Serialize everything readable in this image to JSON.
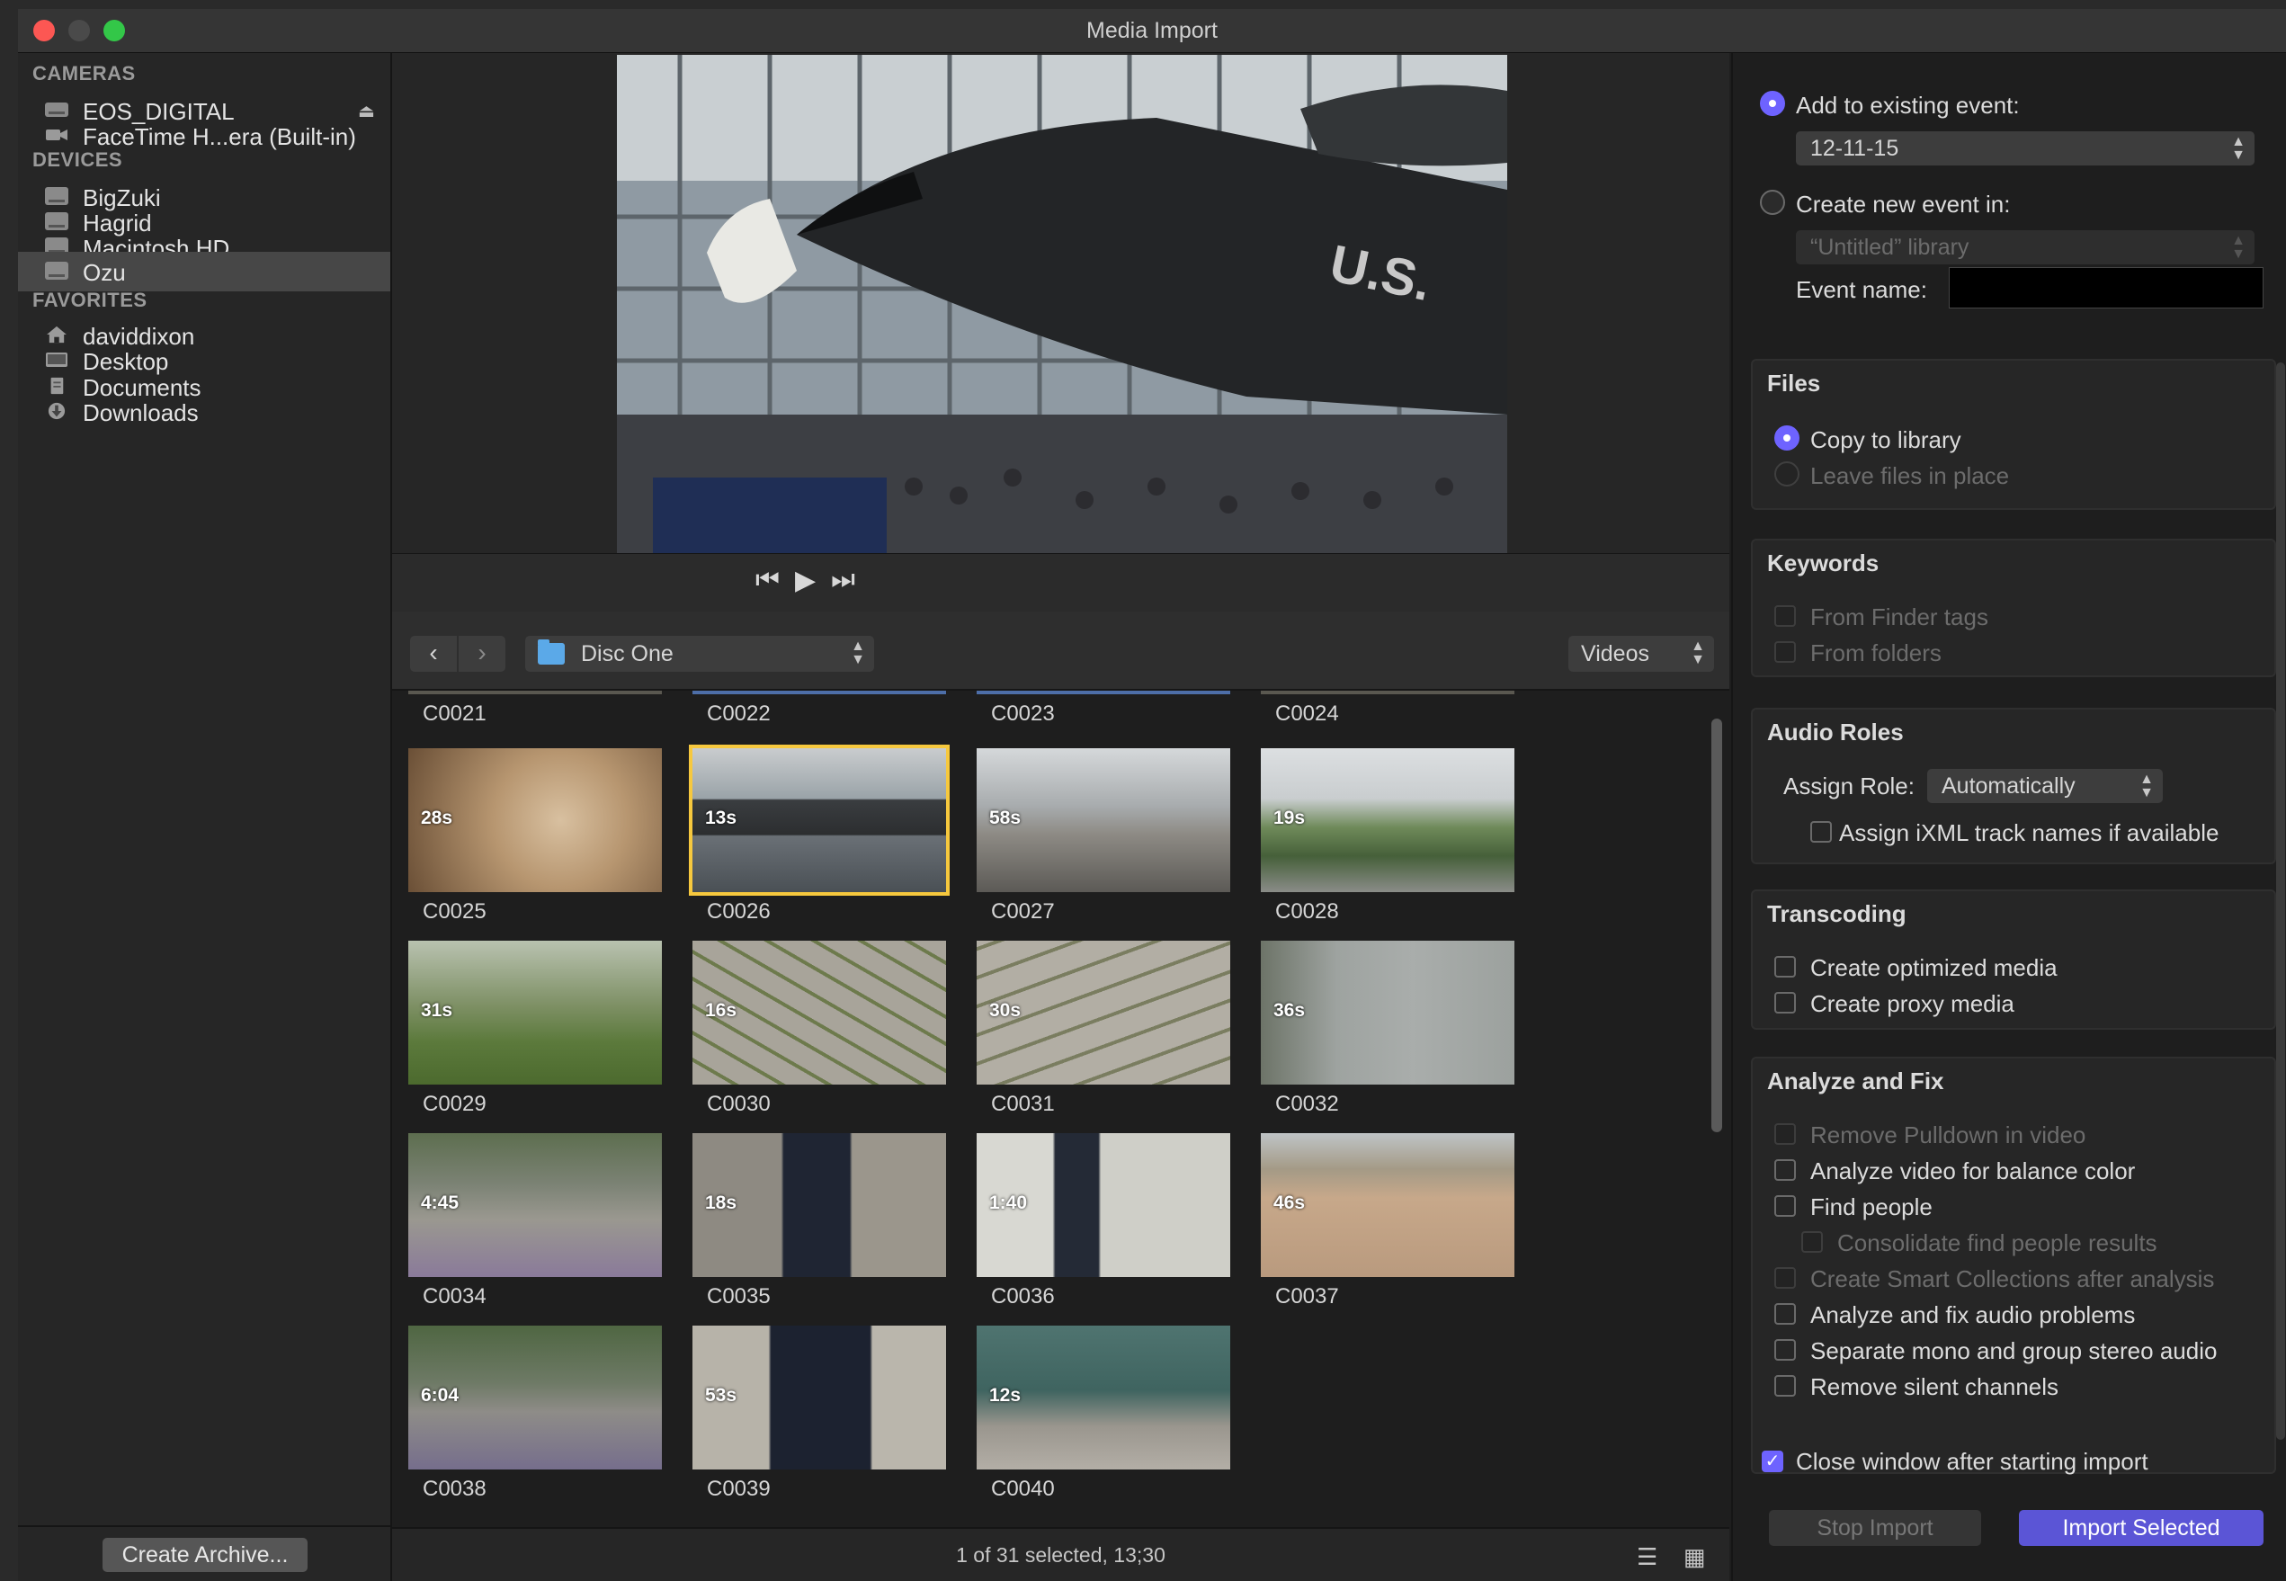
{
  "window": {
    "title": "Media Import"
  },
  "sidebar": {
    "cameras_title": "CAMERAS",
    "cameras": [
      {
        "label": "EOS_DIGITAL",
        "icon": "camera-card-icon",
        "eject": "⏏"
      },
      {
        "label": "FaceTime H...era (Built-in)",
        "icon": "facetime-camera-icon"
      }
    ],
    "devices_title": "DEVICES",
    "devices": [
      {
        "label": "BigZuki",
        "icon": "hard-disk-icon"
      },
      {
        "label": "Hagrid",
        "icon": "hard-disk-icon"
      },
      {
        "label": "Macintosh HD",
        "icon": "hard-disk-icon"
      },
      {
        "label": "Ozu",
        "icon": "hard-disk-icon",
        "selected": true
      }
    ],
    "favorites_title": "FAVORITES",
    "favorites": [
      {
        "label": "daviddixon",
        "icon": "home-icon"
      },
      {
        "label": "Desktop",
        "icon": "desktop-icon"
      },
      {
        "label": "Documents",
        "icon": "documents-icon"
      },
      {
        "label": "Downloads",
        "icon": "downloads-icon"
      }
    ],
    "create_archive": "Create Archive..."
  },
  "browser": {
    "folder": "Disc One",
    "filter": "Videos",
    "top_row": [
      "C0021",
      "C0022",
      "C0023",
      "C0024"
    ],
    "clips": [
      {
        "name": "C0025",
        "duration": "28s"
      },
      {
        "name": "C0026",
        "duration": "13s",
        "selected": true
      },
      {
        "name": "C0027",
        "duration": "58s"
      },
      {
        "name": "C0028",
        "duration": "19s"
      },
      {
        "name": "C0029",
        "duration": "31s"
      },
      {
        "name": "C0030",
        "duration": "16s"
      },
      {
        "name": "C0031",
        "duration": "30s"
      },
      {
        "name": "C0032",
        "duration": "36s"
      },
      {
        "name": "C0034",
        "duration": "4:45"
      },
      {
        "name": "C0035",
        "duration": "18s"
      },
      {
        "name": "C0036",
        "duration": "1:40"
      },
      {
        "name": "C0037",
        "duration": "46s"
      },
      {
        "name": "C0038",
        "duration": "6:04"
      },
      {
        "name": "C0039",
        "duration": "53s"
      },
      {
        "name": "C0040",
        "duration": "12s"
      }
    ],
    "status": "1 of 31 selected, 13;30"
  },
  "options": {
    "add_existing_label": "Add to existing event:",
    "existing_event": "12-11-15",
    "create_new_label": "Create new event in:",
    "new_event_library": "“Untitled” library",
    "event_name_label": "Event name:",
    "event_name_value": "",
    "files": {
      "title": "Files",
      "copy": "Copy to library",
      "leave": "Leave files in place"
    },
    "keywords": {
      "title": "Keywords",
      "finder_tags": "From Finder tags",
      "folders": "From folders"
    },
    "audio_roles": {
      "title": "Audio Roles",
      "assign_role_label": "Assign Role:",
      "assign_role_value": "Automatically",
      "ixml": "Assign iXML track names if available"
    },
    "transcoding": {
      "title": "Transcoding",
      "optimized": "Create optimized media",
      "proxy": "Create proxy media"
    },
    "analyze": {
      "title": "Analyze and Fix",
      "pulldown": "Remove Pulldown in video",
      "balance": "Analyze video for balance color",
      "find_people": "Find people",
      "consolidate": "Consolidate find people results",
      "smart_collections": "Create Smart Collections after analysis",
      "audio_problems": "Analyze and fix audio problems",
      "mono": "Separate mono and group stereo audio",
      "silent": "Remove silent channels"
    },
    "close_window": "Close window after starting import",
    "stop_import": "Stop Import",
    "import_selected": "Import Selected"
  },
  "colors": {
    "accent": "#6e63ff",
    "selection": "#f6c83e",
    "import_button": "#5b55d6"
  }
}
